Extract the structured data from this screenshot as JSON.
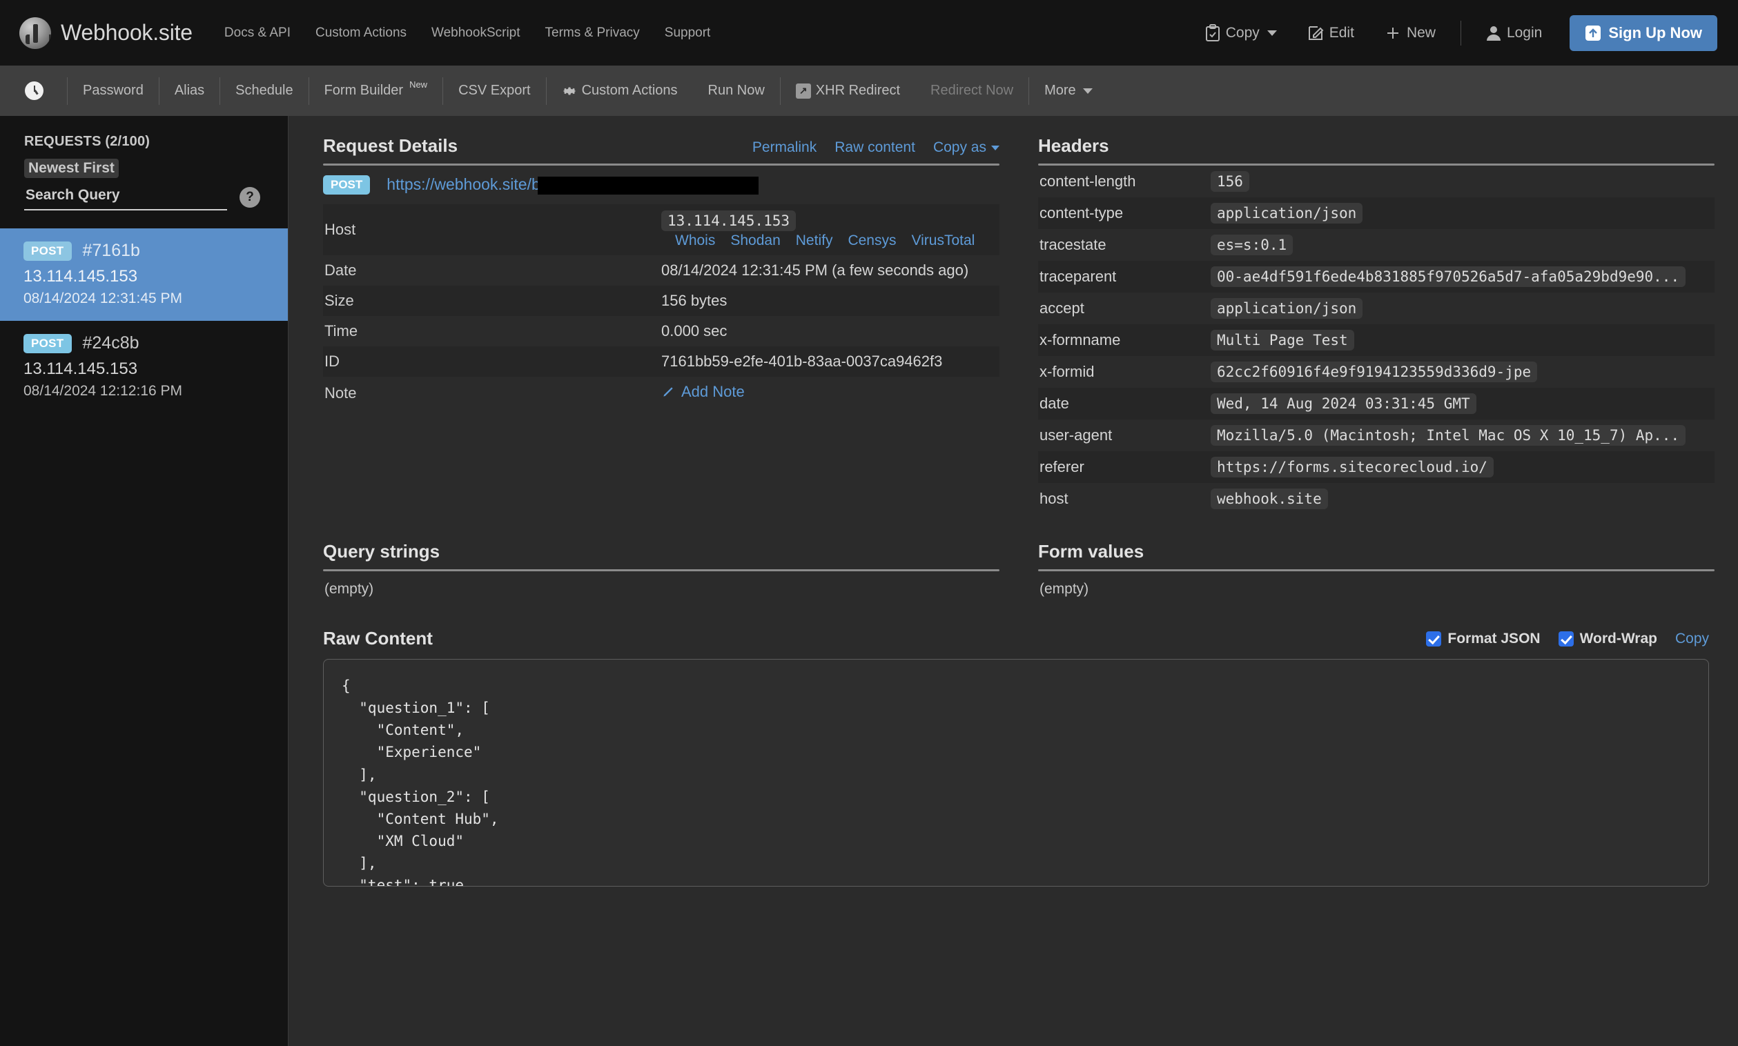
{
  "header": {
    "brand": "Webhook.site",
    "nav": [
      {
        "label": "Docs & API"
      },
      {
        "label": "Custom Actions"
      },
      {
        "label": "WebhookScript"
      },
      {
        "label": "Terms & Privacy"
      },
      {
        "label": "Support"
      }
    ],
    "actions": {
      "copy": "Copy",
      "edit": "Edit",
      "new": "New",
      "login": "Login",
      "signup": "Sign Up Now"
    }
  },
  "toolbar": {
    "items": [
      {
        "label": "Password"
      },
      {
        "label": "Alias"
      },
      {
        "label": "Schedule"
      },
      {
        "label": "Form Builder",
        "badge": "New"
      },
      {
        "label": "CSV Export"
      },
      {
        "label": "Custom Actions"
      },
      {
        "label": "Run Now"
      },
      {
        "label": "XHR Redirect"
      },
      {
        "label": "Redirect Now"
      },
      {
        "label": "More"
      }
    ]
  },
  "sidebar": {
    "title": "REQUESTS (2/100)",
    "sort": "Newest First",
    "search_placeholder": "Search Query",
    "help": "?",
    "requests": [
      {
        "method": "POST",
        "id": "#7161b",
        "ip": "13.114.145.153",
        "date": "08/14/2024 12:31:45 PM",
        "selected": true
      },
      {
        "method": "POST",
        "id": "#24c8b",
        "ip": "13.114.145.153",
        "date": "08/14/2024 12:12:16 PM",
        "selected": false
      }
    ]
  },
  "request_details": {
    "title": "Request Details",
    "links": {
      "permalink": "Permalink",
      "raw_content": "Raw content",
      "copy_as": "Copy as"
    },
    "method": "POST",
    "url": "https://webhook.site/b",
    "rows": [
      {
        "key": "Host",
        "value": "13.114.145.153"
      },
      {
        "key": "Date",
        "value": "08/14/2024 12:31:45 PM (a few seconds ago)"
      },
      {
        "key": "Size",
        "value": "156 bytes"
      },
      {
        "key": "Time",
        "value": "0.000 sec"
      },
      {
        "key": "ID",
        "value": "7161bb59-e2fe-401b-83aa-0037ca9462f3"
      },
      {
        "key": "Note",
        "value": "Add Note"
      }
    ],
    "host_lookups": [
      "Whois",
      "Shodan",
      "Netify",
      "Censys",
      "VirusTotal"
    ]
  },
  "headers_panel": {
    "title": "Headers",
    "rows": [
      {
        "key": "content-length",
        "value": "156"
      },
      {
        "key": "content-type",
        "value": "application/json"
      },
      {
        "key": "tracestate",
        "value": "es=s:0.1"
      },
      {
        "key": "traceparent",
        "value": "00-ae4df591f6ede4b831885f970526a5d7-afa05a29bd9e90..."
      },
      {
        "key": "accept",
        "value": "application/json"
      },
      {
        "key": "x-formname",
        "value": "Multi Page Test"
      },
      {
        "key": "x-formid",
        "value": "62cc2f60916f4e9f9194123559d336d9-jpe"
      },
      {
        "key": "date",
        "value": "Wed, 14 Aug 2024 03:31:45 GMT"
      },
      {
        "key": "user-agent",
        "value": "Mozilla/5.0 (Macintosh; Intel Mac OS X 10_15_7) Ap..."
      },
      {
        "key": "referer",
        "value": "https://forms.sitecorecloud.io/"
      },
      {
        "key": "host",
        "value": "webhook.site"
      }
    ]
  },
  "query_strings": {
    "title": "Query strings",
    "empty": "(empty)"
  },
  "form_values": {
    "title": "Form values",
    "empty": "(empty)"
  },
  "raw_content": {
    "title": "Raw Content",
    "format_json_label": "Format JSON",
    "word_wrap_label": "Word-Wrap",
    "copy_label": "Copy",
    "body": "{\n  \"question_1\": [\n    \"Content\",\n    \"Experience\"\n  ],\n  \"question_2\": [\n    \"Content Hub\",\n    \"XM Cloud\"\n  ],\n  \"test\": true\n}"
  },
  "colors": {
    "accent_blue": "#5e9bd8",
    "signup_blue": "#4a7eb8",
    "selected_row": "#5b8fc9",
    "method_badge": "#7dc5e4",
    "checkbox_blue": "#2d6fe8",
    "header_bg": "#141414",
    "toolbar_bg": "#3f3f3f",
    "main_bg": "#2b2b2b"
  }
}
